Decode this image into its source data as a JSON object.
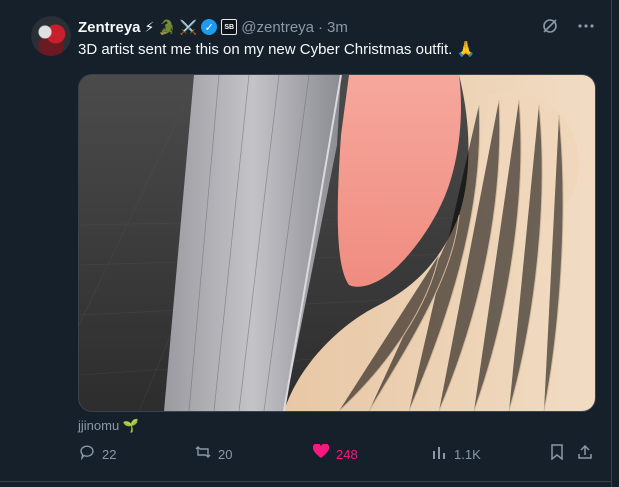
{
  "tweet": {
    "author": {
      "name": "Zentreya",
      "badges": [
        "⚡",
        "🐊",
        "⚔️"
      ],
      "handle": "@zentreya",
      "time": "3m",
      "verified": true
    },
    "text": "3D artist sent me this on my new Cyber Christmas outfit. 🙏",
    "media_credit": "jjinomu 🌱",
    "actions": {
      "reply": "22",
      "retweet": "20",
      "like": "248",
      "views": "1.1K"
    }
  },
  "icons": {
    "grok": "grok-icon",
    "more": "more-icon",
    "reply": "reply-icon",
    "retweet": "retweet-icon",
    "like": "heart-icon",
    "views": "views-icon",
    "bookmark": "bookmark-icon",
    "share": "share-icon"
  },
  "colors": {
    "background": "#15202b",
    "text": "#f7f9f9",
    "muted": "#8b98a5",
    "like": "#f91880",
    "verified": "#1d9bf0"
  }
}
